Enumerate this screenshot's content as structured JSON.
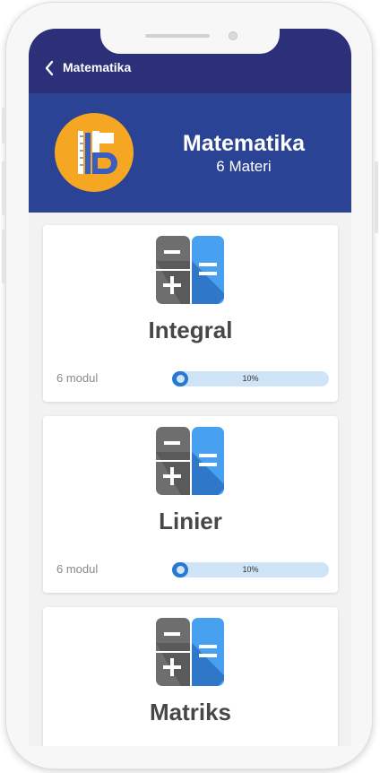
{
  "appbar": {
    "title": "Matematika"
  },
  "hero": {
    "title": "Matematika",
    "subtitle": "6 Materi"
  },
  "cards": [
    {
      "title": "Integral",
      "count": "6 modul",
      "progress_label": "10%",
      "progress": 0.1
    },
    {
      "title": "Linier",
      "count": "6 modul",
      "progress_label": "10%",
      "progress": 0.1
    },
    {
      "title": "Matriks",
      "count": "",
      "progress_label": "",
      "progress": null
    }
  ],
  "colors": {
    "appbar": "#2b3079",
    "hero": "#2a4394",
    "accent": "#2979d2",
    "subject_icon_bg": "#f5a623"
  },
  "icons": {
    "back": "chevron-left-icon",
    "subject": "ruler-pencil-icon",
    "material": "calculator-icon"
  }
}
